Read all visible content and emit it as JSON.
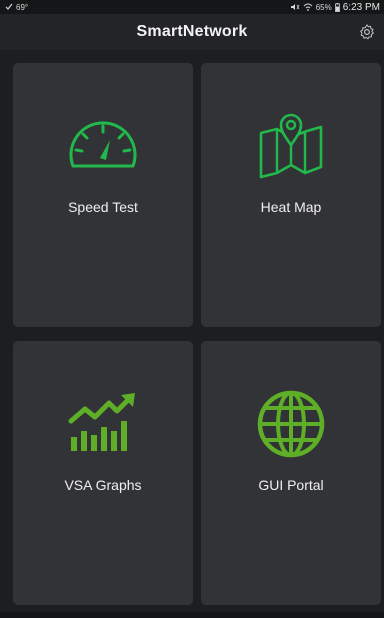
{
  "status_bar": {
    "temp": "69°",
    "battery": "65%",
    "time": "6:23 PM"
  },
  "app_bar": {
    "title": "SmartNetwork",
    "settings_icon": "gear-icon"
  },
  "tiles": [
    {
      "label": "Speed Test",
      "icon": "speedometer-icon"
    },
    {
      "label": "Heat Map",
      "icon": "map-pin-icon"
    },
    {
      "label": "VSA Graphs",
      "icon": "bar-chart-trend-icon"
    },
    {
      "label": "GUI Portal",
      "icon": "globe-icon"
    }
  ],
  "colors": {
    "accent": "#22b94c",
    "accent_dark": "#5fae28",
    "tile_bg": "#323336",
    "background": "#1d1e20"
  }
}
